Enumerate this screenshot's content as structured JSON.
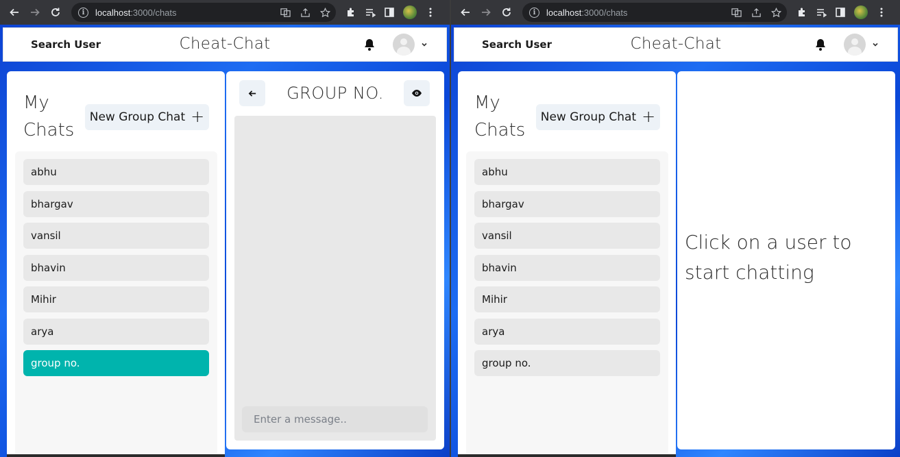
{
  "browser": {
    "url_host": "localhost",
    "url_path": ":3000/chats"
  },
  "header": {
    "search_label": "Search User",
    "app_title": "Cheat-Chat"
  },
  "sidebar": {
    "title_line1": "My",
    "title_line2": "Chats",
    "new_group_label": "New Group Chat",
    "new_group_icon": "+",
    "chats": [
      "abhu",
      "bhargav",
      "vansil",
      "bhavin",
      "Mihir",
      "arya",
      "group no."
    ],
    "active_index": 6
  },
  "conversation": {
    "title": "GROUP NO.",
    "input_placeholder": "Enter a message.."
  },
  "empty_state": {
    "message": "Click on a user to start chatting"
  },
  "colors": {
    "active_chat": "#00b4ad",
    "button_bg": "#edf2f7",
    "background_blue": "#1a4fd6"
  }
}
